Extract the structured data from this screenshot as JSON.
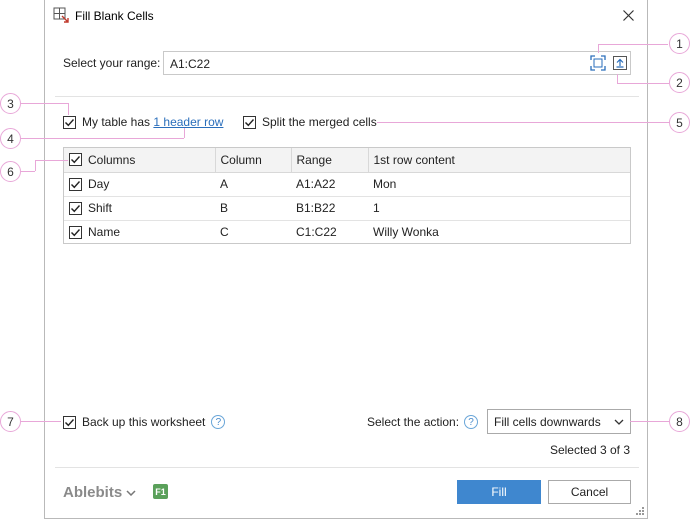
{
  "window": {
    "title": "Fill Blank Cells",
    "icons": {
      "app": "fill-blank-cells-icon",
      "close": "close-icon"
    }
  },
  "range": {
    "label": "Select your range:",
    "value": "A1:C22",
    "select_range_icon": "select-range-icon",
    "expand_icon": "expand-selection-icon"
  },
  "options": {
    "header_prefix": "My table has",
    "header_link": "1 header row",
    "header_checked": true,
    "split_merged": "Split the merged cells",
    "split_checked": true
  },
  "table": {
    "columns": [
      "Columns",
      "Column",
      "Range",
      "1st row content"
    ],
    "header_checked": true,
    "rows": [
      {
        "checked": true,
        "name": "Day",
        "column": "A",
        "range": "A1:A22",
        "content": "Mon"
      },
      {
        "checked": true,
        "name": "Shift",
        "column": "B",
        "range": "B1:B22",
        "content": "1"
      },
      {
        "checked": true,
        "name": "Name",
        "column": "C",
        "range": "C1:C22",
        "content": "Willy Wonka"
      }
    ]
  },
  "backup": {
    "label": "Back up this worksheet",
    "checked": true,
    "help": "?"
  },
  "action": {
    "label": "Select the action:",
    "help": "?",
    "selected": "Fill cells downwards"
  },
  "status": {
    "selected_count": "Selected 3 of 3"
  },
  "footer": {
    "brand": "Ablebits",
    "f1": "F1",
    "fill": "Fill",
    "cancel": "Cancel"
  },
  "callouts": [
    "1",
    "2",
    "3",
    "4",
    "5",
    "6",
    "7",
    "8"
  ],
  "colors": {
    "accent": "#3f87cf",
    "link": "#2a6ebb",
    "callout": "#e8a7d8",
    "f1_badge": "#5aa05a"
  }
}
